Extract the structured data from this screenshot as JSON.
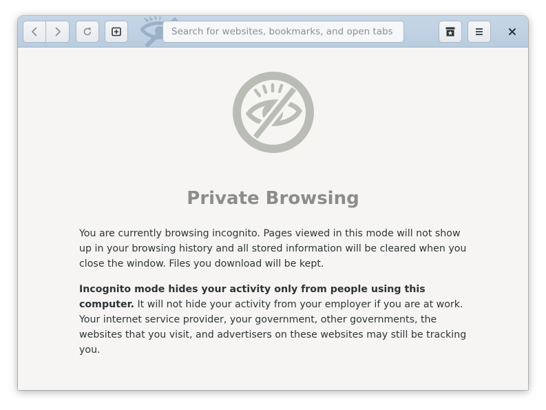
{
  "headerbar": {
    "back_icon": "chevron-left-icon",
    "forward_icon": "chevron-right-icon",
    "reload_icon": "reload-icon",
    "new_tab_icon": "new-tab-icon",
    "search_placeholder": "Search for websites, bookmarks, and open tabs",
    "search_value": "",
    "bookmarks_icon": "bookmark-star-icon",
    "menu_icon": "hamburger-menu-icon",
    "close_icon": "close-icon"
  },
  "main": {
    "icon": "private-browsing-eye-icon",
    "title": "Private Browsing",
    "paragraph1": "You are currently browsing incognito. Pages viewed in this mode will not show up in your browsing history and all stored information will be cleared when you close the window. Files you download will be kept.",
    "paragraph2_bold": "Incognito mode hides your activity only from people using this computer.",
    "paragraph2_rest": " It will not hide your activity from your employer if you are at work. Your internet service provider, your government, other governments, the websites that you visit, and advertisers on these websites may still be tracking you."
  },
  "colors": {
    "headerbar": "#bfd2e4",
    "background": "#f6f5f4",
    "icon_gray": "#babdb6",
    "title_gray": "#8b8d8a",
    "text": "#2e3436"
  }
}
